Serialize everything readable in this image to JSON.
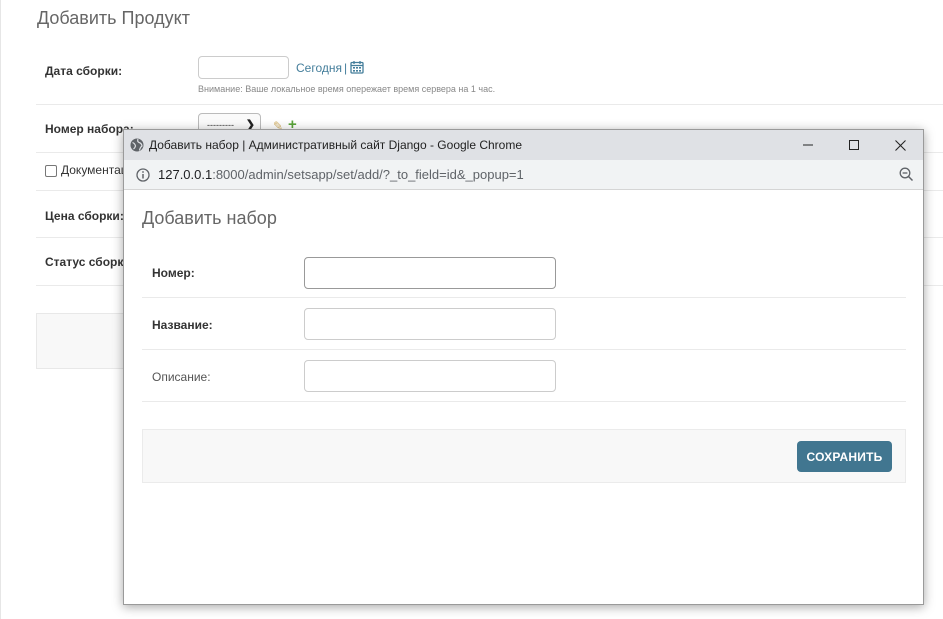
{
  "background": {
    "title": "Добавить Продукт",
    "assembly_date": {
      "label": "Дата сборки:",
      "value": "",
      "today_link": "Сегодня",
      "separator": "|",
      "note": "Внимание: Ваше локальное время опережает время сервера на 1 час."
    },
    "set_number": {
      "label": "Номер набора:",
      "selected": "---------"
    },
    "documentation": {
      "label": "Документация"
    },
    "assembly_price": {
      "label": "Цена сборки:"
    },
    "assembly_status": {
      "label": "Статус сборки:"
    }
  },
  "popup": {
    "window_title": "Добавить набор | Административный сайт Django - Google Chrome",
    "url_host": "127.0.0.1",
    "url_path": ":8000/admin/setsapp/set/add/?_to_field=id&_popup=1",
    "heading": "Добавить набор",
    "fields": {
      "number": {
        "label": "Номер:",
        "value": ""
      },
      "name": {
        "label": "Название:",
        "value": ""
      },
      "description": {
        "label": "Описание:",
        "value": ""
      }
    },
    "save_label": "СОХРАНИТЬ"
  },
  "colors": {
    "accent": "#417690",
    "link": "#447e9b",
    "titlebar": "#dfe1e5",
    "addressbar": "#f1f3f4"
  },
  "icons": {
    "calendar": "calendar-icon",
    "edit": "pencil-icon",
    "add": "plus-icon",
    "globe": "globe-icon",
    "info": "info-icon",
    "zoom": "zoom-out-icon"
  }
}
